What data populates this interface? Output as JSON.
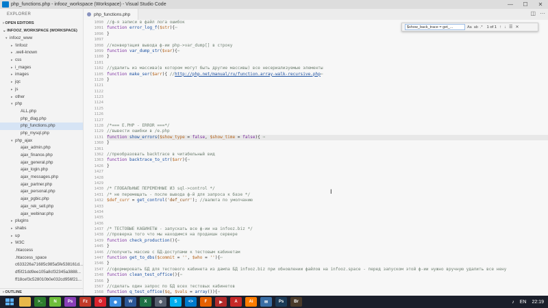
{
  "window": {
    "title": "php_functions.php - infooz_workspace (Workspace) - Visual Studio Code",
    "minimize_glyph": "—",
    "maximize_glyph": "☐",
    "close_glyph": "✕"
  },
  "sidebar": {
    "header": "EXPLORER",
    "open_editors": "OPEN EDITORS",
    "workspace": "INFOOZ_WORKSPACE (WORKSPACE)",
    "outline": "OUTLINE",
    "items": [
      {
        "label": "infooz_www",
        "depth": 0,
        "toggle": "▾",
        "selected": false
      },
      {
        "label": "!infooz",
        "depth": 1,
        "toggle": "▸",
        "selected": false
      },
      {
        "label": ".well-known",
        "depth": 1,
        "toggle": "▸",
        "selected": false
      },
      {
        "label": "css",
        "depth": 1,
        "toggle": "▸",
        "selected": false
      },
      {
        "label": "i_mages",
        "depth": 1,
        "toggle": "▸",
        "selected": false
      },
      {
        "label": "images",
        "depth": 1,
        "toggle": "▸",
        "selected": false
      },
      {
        "label": "jqc",
        "depth": 1,
        "toggle": "▸",
        "selected": false
      },
      {
        "label": "js",
        "depth": 1,
        "toggle": "▸",
        "selected": false
      },
      {
        "label": "other",
        "depth": 1,
        "toggle": "▸",
        "selected": false
      },
      {
        "label": "php",
        "depth": 1,
        "toggle": "▾",
        "selected": false
      },
      {
        "label": "ALL.php",
        "depth": 2,
        "toggle": "",
        "selected": false
      },
      {
        "label": "php_dlag.php",
        "depth": 2,
        "toggle": "",
        "selected": false
      },
      {
        "label": "php_functions.php",
        "depth": 2,
        "toggle": "",
        "selected": true
      },
      {
        "label": "php_mysql.php",
        "depth": 2,
        "toggle": "",
        "selected": false
      },
      {
        "label": "php_ajax",
        "depth": 1,
        "toggle": "▾",
        "selected": false
      },
      {
        "label": "ajax_admin.php",
        "depth": 2,
        "toggle": "",
        "selected": false
      },
      {
        "label": "ajax_finance.php",
        "depth": 2,
        "toggle": "",
        "selected": false
      },
      {
        "label": "ajax_general.php",
        "depth": 2,
        "toggle": "",
        "selected": false
      },
      {
        "label": "ajax_login.php",
        "depth": 2,
        "toggle": "",
        "selected": false
      },
      {
        "label": "ajax_messages.php",
        "depth": 2,
        "toggle": "",
        "selected": false
      },
      {
        "label": "ajax_partner.php",
        "depth": 2,
        "toggle": "",
        "selected": false
      },
      {
        "label": "ajax_personal.php",
        "depth": 2,
        "toggle": "",
        "selected": false
      },
      {
        "label": "ajax_pgbic.php",
        "depth": 2,
        "toggle": "",
        "selected": false
      },
      {
        "label": "ajax_rek_sell.php",
        "depth": 2,
        "toggle": "",
        "selected": false
      },
      {
        "label": "ajax_webinar.php",
        "depth": 2,
        "toggle": "",
        "selected": false
      },
      {
        "label": "plugins",
        "depth": 1,
        "toggle": "▸",
        "selected": false
      },
      {
        "label": "shabs",
        "depth": 1,
        "toggle": "▸",
        "selected": false
      },
      {
        "label": "up",
        "depth": 1,
        "toggle": "▸",
        "selected": false
      },
      {
        "label": "W3C",
        "depth": 1,
        "toggle": "▸",
        "selected": false
      },
      {
        "label": ".htaccess",
        "depth": 1,
        "toggle": "",
        "selected": false
      },
      {
        "label": ".htaccess_space",
        "depth": 1,
        "toggle": "",
        "selected": false
      },
      {
        "label": "c633226a71685c985a5fe538161d...",
        "depth": 1,
        "toggle": "",
        "selected": false
      },
      {
        "label": "df5f21dd9ee105a8cf32345a3888...",
        "depth": 1,
        "toggle": "",
        "selected": false
      },
      {
        "label": "ff18cef3c528010b0e032cd956f21...",
        "depth": 1,
        "toggle": "",
        "selected": false
      }
    ]
  },
  "tabs": [
    {
      "label": "php_functions.php",
      "active": true
    }
  ],
  "find": {
    "query": "$show_back_trace = get_...",
    "match_case": "Aa",
    "whole_word": "ab",
    "regex": ".*",
    "count": "1 of 1",
    "prev": "↑",
    "next": "↓",
    "selection": "☰",
    "close": "✕"
  },
  "editor": {
    "lines": [
      {
        "n": "1090",
        "hl": false,
        "t": [
          [
            "c-com",
            "//ф-я записи в файл лога ошибок"
          ]
        ]
      },
      {
        "n": "1091",
        "hl": false,
        "t": [
          [
            "c-kw",
            "function "
          ],
          [
            "c-fn",
            "error_log_f"
          ],
          [
            "c-op",
            "("
          ],
          [
            "c-var",
            "$str"
          ],
          [
            "c-op",
            "){"
          ],
          [
            "c-com",
            "⋯"
          ]
        ]
      },
      {
        "n": "1096",
        "hl": false,
        "t": [
          [
            "c-op",
            "}"
          ]
        ]
      },
      {
        "n": "1097",
        "hl": false,
        "t": []
      },
      {
        "n": "1098",
        "hl": false,
        "t": [
          [
            "c-com",
            "//конвертация вывода ф-ии php->var_dump[] в строку"
          ]
        ]
      },
      {
        "n": "1099",
        "hl": false,
        "t": [
          [
            "c-kw",
            "function "
          ],
          [
            "c-fn",
            "var_dump_str"
          ],
          [
            "c-op",
            "("
          ],
          [
            "c-var",
            "$var"
          ],
          [
            "c-op",
            "){"
          ],
          [
            "c-com",
            "⋯"
          ]
        ]
      },
      {
        "n": "1100",
        "hl": false,
        "t": [
          [
            "c-op",
            "}"
          ]
        ]
      },
      {
        "n": "1101",
        "hl": false,
        "t": []
      },
      {
        "n": "1102",
        "hl": false,
        "t": [
          [
            "c-com",
            "//удалить из массива(в котором могут быть другие массивы) все несериализуемые элементы"
          ]
        ]
      },
      {
        "n": "1105",
        "hl": false,
        "t": [
          [
            "c-kw",
            "function "
          ],
          [
            "c-fn",
            "make_ser"
          ],
          [
            "c-op",
            "("
          ],
          [
            "c-var",
            "$arr"
          ],
          [
            "c-op",
            "){ "
          ],
          [
            "c-com",
            "//"
          ],
          [
            "c-lnk",
            "http://php.net/manual/ru/function.array-walk-recursive.php"
          ],
          [
            "c-com",
            "⋯"
          ]
        ]
      },
      {
        "n": "1120",
        "hl": false,
        "t": [
          [
            "c-op",
            "}"
          ]
        ]
      },
      {
        "n": "1121",
        "hl": false,
        "t": []
      },
      {
        "n": "1122",
        "hl": false,
        "t": []
      },
      {
        "n": "1123",
        "hl": false,
        "t": []
      },
      {
        "n": "1124",
        "hl": false,
        "t": []
      },
      {
        "n": "1125",
        "hl": false,
        "t": []
      },
      {
        "n": "1126",
        "hl": false,
        "t": []
      },
      {
        "n": "1127",
        "hl": false,
        "t": []
      },
      {
        "n": "1128",
        "hl": false,
        "t": [
          [
            "c-com",
            "/*=== E.PHP - ERROR ===*/"
          ]
        ]
      },
      {
        "n": "1129",
        "hl": false,
        "t": [
          [
            "c-com",
            "//вывести ошибки в /e.php"
          ]
        ]
      },
      {
        "n": "1131",
        "hl": true,
        "t": [
          [
            "c-kw",
            "function "
          ],
          [
            "c-fn",
            "show_errors"
          ],
          [
            "c-op",
            "("
          ],
          [
            "c-var",
            "$show_type"
          ],
          [
            "c-op",
            " = "
          ],
          [
            "c-kw",
            "false"
          ],
          [
            "c-op",
            ", "
          ],
          [
            "c-var",
            "$show_time"
          ],
          [
            "c-op",
            " = "
          ],
          [
            "c-kw",
            "false"
          ],
          [
            "c-op",
            "){ "
          ],
          [
            "c-com",
            "⋯"
          ]
        ]
      },
      {
        "n": "1360",
        "hl": false,
        "t": [
          [
            "c-op",
            "}"
          ]
        ]
      },
      {
        "n": "1361",
        "hl": false,
        "t": []
      },
      {
        "n": "1362",
        "hl": false,
        "t": [
          [
            "c-com",
            "//преобразовать backtrace в читабельный вид"
          ]
        ]
      },
      {
        "n": "1363",
        "hl": false,
        "t": [
          [
            "c-kw",
            "function "
          ],
          [
            "c-fn",
            "backtrace_to_str"
          ],
          [
            "c-op",
            "("
          ],
          [
            "c-var",
            "$arr"
          ],
          [
            "c-op",
            "){"
          ],
          [
            "c-com",
            "⋯"
          ]
        ]
      },
      {
        "n": "1426",
        "hl": false,
        "t": [
          [
            "c-op",
            "}"
          ]
        ]
      },
      {
        "n": "1427",
        "hl": false,
        "t": []
      },
      {
        "n": "1428",
        "hl": false,
        "t": []
      },
      {
        "n": "1429",
        "hl": false,
        "t": []
      },
      {
        "n": "1430",
        "hl": false,
        "t": [
          [
            "c-com",
            "/* ГЛОБАЛЬНЫЕ ПЕРЕМЕННЫЕ ИЗ sql->control */"
          ]
        ]
      },
      {
        "n": "1431",
        "hl": false,
        "t": [
          [
            "c-com",
            "/* не перемещать - после вывода ф-й для запроса к базе */"
          ]
        ]
      },
      {
        "n": "1432",
        "hl": false,
        "t": [
          [
            "c-var",
            "$def_curr"
          ],
          [
            "c-op",
            " = "
          ],
          [
            "c-fn",
            "get_control"
          ],
          [
            "c-op",
            "("
          ],
          [
            "c-str",
            "'def_curr'"
          ],
          [
            "c-op",
            "); "
          ],
          [
            "c-com",
            "//валюта по умолчанию"
          ]
        ]
      },
      {
        "n": "1433",
        "hl": false,
        "t": []
      },
      {
        "n": "1434",
        "hl": false,
        "t": []
      },
      {
        "n": "1435",
        "hl": false,
        "t": []
      },
      {
        "n": "1436",
        "hl": false,
        "t": []
      },
      {
        "n": "1437",
        "hl": false,
        "t": [
          [
            "c-com",
            "/* ТЕСТОВЫЕ КАБИНЕТЫ - запускать все ф-ии на infooz.biz */"
          ]
        ]
      },
      {
        "n": "1438",
        "hl": false,
        "t": [
          [
            "c-com",
            "//проверка того что мы находимся на продакшн сервере"
          ]
        ]
      },
      {
        "n": "1439",
        "hl": false,
        "t": [
          [
            "c-kw",
            "function "
          ],
          [
            "c-fn",
            "check_production"
          ],
          [
            "c-op",
            "(){"
          ],
          [
            "c-com",
            "⋯"
          ]
        ]
      },
      {
        "n": "1445",
        "hl": false,
        "t": [
          [
            "c-op",
            "}"
          ]
        ]
      },
      {
        "n": "1446",
        "hl": false,
        "t": [
          [
            "c-com",
            "//получить массив с БД-доступами к тестовым кабинетам"
          ]
        ]
      },
      {
        "n": "1447",
        "hl": false,
        "t": [
          [
            "c-kw",
            "function "
          ],
          [
            "c-fn",
            "get_to_dbs"
          ],
          [
            "c-op",
            "("
          ],
          [
            "c-var",
            "$commit"
          ],
          [
            "c-op",
            " = "
          ],
          [
            "c-str",
            "''"
          ],
          [
            "c-op",
            ", "
          ],
          [
            "c-var",
            "$who"
          ],
          [
            "c-op",
            " = "
          ],
          [
            "c-str",
            "''"
          ],
          [
            "c-op",
            "){"
          ],
          [
            "c-com",
            "⋯"
          ]
        ]
      },
      {
        "n": "1546",
        "hl": false,
        "t": [
          [
            "c-op",
            "}"
          ]
        ]
      },
      {
        "n": "1547",
        "hl": false,
        "t": [
          [
            "c-com",
            "//сформировать БД для тестового кабинета из дампа БД infooz.biz при обновлении файлов на infooz.space - перед запуском этой ф-ии нужно вручную удалить все нену"
          ]
        ]
      },
      {
        "n": "1548",
        "hl": false,
        "t": [
          [
            "c-kw",
            "function "
          ],
          [
            "c-fn",
            "clean_test_office"
          ],
          [
            "c-op",
            "(){"
          ],
          [
            "c-com",
            "⋯"
          ]
        ]
      },
      {
        "n": "1566",
        "hl": false,
        "t": [
          [
            "c-op",
            "}"
          ]
        ]
      },
      {
        "n": "1567",
        "hl": false,
        "t": [
          [
            "c-com",
            "//сделать один запрос по БД всех тестовых кабинетов"
          ]
        ]
      },
      {
        "n": "1568",
        "hl": false,
        "t": [
          [
            "c-kw",
            "function "
          ],
          [
            "c-fn",
            "q_test_office"
          ],
          [
            "c-op",
            "("
          ],
          [
            "c-var",
            "$q"
          ],
          [
            "c-op",
            ", "
          ],
          [
            "c-var",
            "$vals"
          ],
          [
            "c-op",
            " = "
          ],
          [
            "c-fn",
            "array"
          ],
          [
            "c-op",
            "()){"
          ],
          [
            "c-com",
            "⋯"
          ]
        ]
      },
      {
        "n": "1579",
        "hl": false,
        "t": [
          [
            "c-op",
            "}"
          ]
        ]
      },
      {
        "n": "1580",
        "hl": false,
        "t": [
          [
            "c-com",
            "//обновить кэш на продакшн и в тестовых кабинетах"
          ]
        ]
      }
    ]
  },
  "cursor_glyph": "I",
  "taskbar": {
    "apps": [
      {
        "name": "explorer-icon",
        "color": "#e8b84a",
        "glyph": ""
      },
      {
        "name": "terminal-icon",
        "color": "#2d7d2d",
        "glyph": ">_"
      },
      {
        "name": "notepadpp-icon",
        "color": "#6fbf3a",
        "glyph": "N"
      },
      {
        "name": "phpstorm-icon",
        "color": "#8a3fb8",
        "glyph": "Ps"
      },
      {
        "name": "filezilla-icon",
        "color": "#c23a2a",
        "glyph": "Fz"
      },
      {
        "name": "opera-icon",
        "color": "#d9232d",
        "glyph": "O"
      },
      {
        "name": "chrome-icon",
        "color": "#3b8de0",
        "glyph": "◉"
      },
      {
        "name": "word-icon",
        "color": "#2b5797",
        "glyph": "W"
      },
      {
        "name": "excel-icon",
        "color": "#1e7145",
        "glyph": "X"
      },
      {
        "name": "settings-icon",
        "color": "#555e6e",
        "glyph": "⚙"
      },
      {
        "name": "skype-icon",
        "color": "#00aff0",
        "glyph": "S"
      },
      {
        "name": "vscode-icon",
        "color": "#007acc",
        "glyph": "<>"
      },
      {
        "name": "firefox-icon",
        "color": "#e66000",
        "glyph": "F"
      },
      {
        "name": "media-icon",
        "color": "#b22b2b",
        "glyph": "▶"
      },
      {
        "name": "acrobat-icon",
        "color": "#c62828",
        "glyph": "A"
      },
      {
        "name": "illustrator-icon",
        "color": "#ff7c00",
        "glyph": "Ai"
      },
      {
        "name": "mail-icon",
        "color": "#3a6ea5",
        "glyph": "✉"
      },
      {
        "name": "photoshop-icon",
        "color": "#1c3b57",
        "glyph": "Ps"
      },
      {
        "name": "bridge-icon",
        "color": "#4a3a2a",
        "glyph": "Br"
      }
    ],
    "lang": "EN",
    "time": "22:19"
  }
}
